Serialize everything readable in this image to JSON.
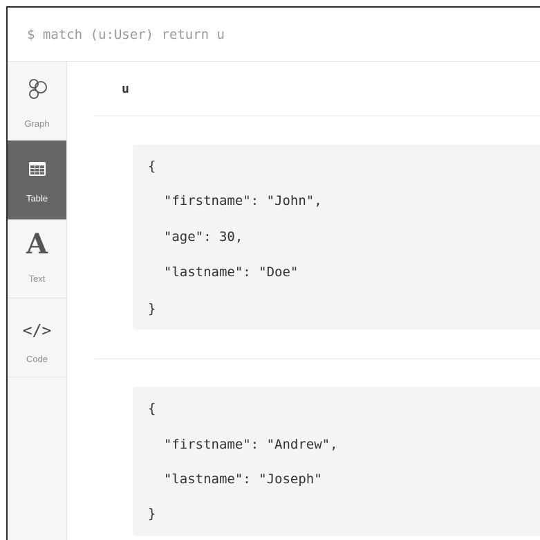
{
  "query": {
    "text": "$ match (u:User) return u"
  },
  "sidebar": {
    "tabs": [
      {
        "label": "Graph",
        "icon": "graph-icon"
      },
      {
        "label": "Table",
        "icon": "table-icon"
      },
      {
        "label": "Text",
        "icon": "text-icon",
        "glyph": "A"
      },
      {
        "label": "Code",
        "icon": "code-icon",
        "glyph": "</>"
      }
    ],
    "active": "Table"
  },
  "table": {
    "column_header": "u",
    "rows": [
      {
        "lines": [
          "{",
          "  \"firstname\": \"John\",",
          "  \"age\": 30,",
          "  \"lastname\": \"Doe\"",
          "}"
        ]
      },
      {
        "lines": [
          "{",
          "  \"firstname\": \"Andrew\",",
          "  \"lastname\": \"Joseph\"",
          "}"
        ]
      }
    ]
  },
  "colors": {
    "active_tab": "#666666",
    "sidebar_bg": "#f6f6f6",
    "card_bg": "#f4f4f4"
  }
}
